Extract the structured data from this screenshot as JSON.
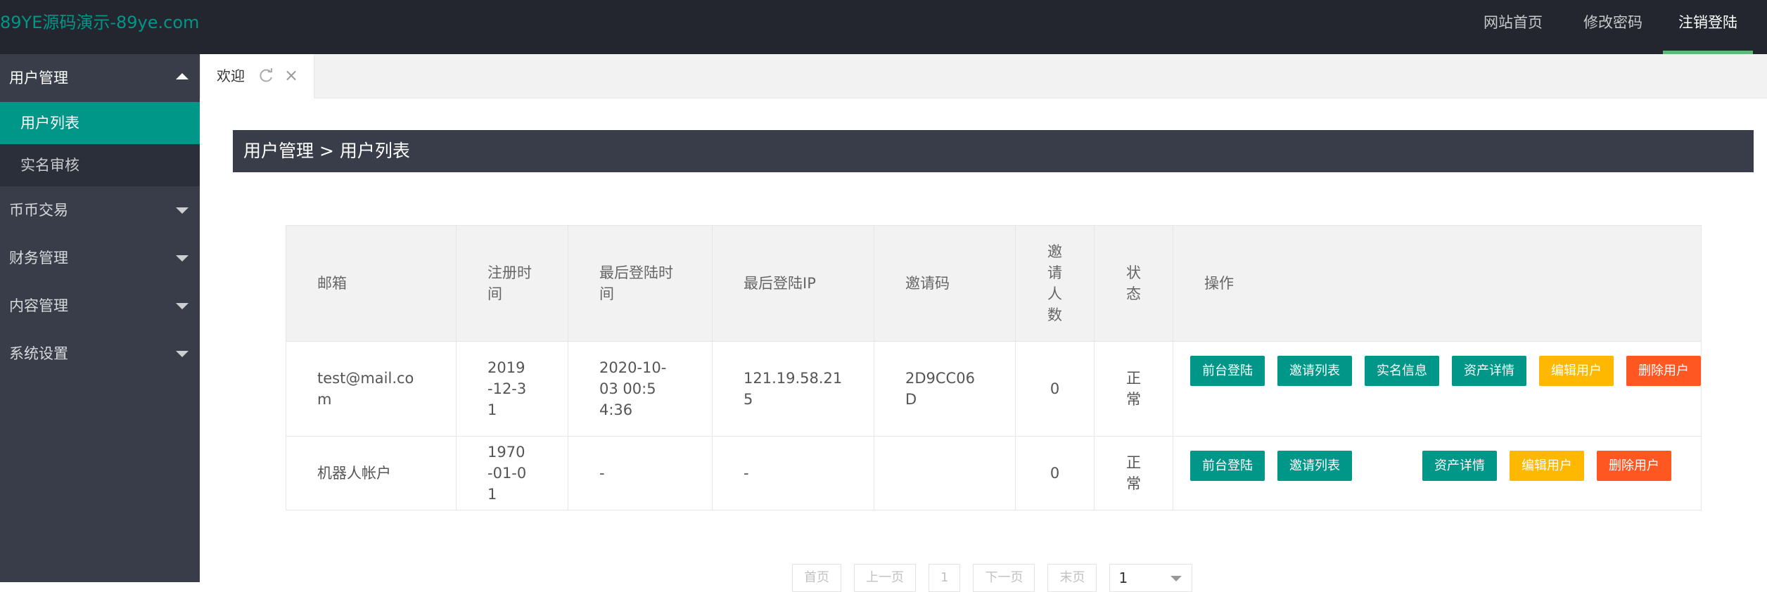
{
  "header": {
    "logo": "89YE源码演示-89ye.com",
    "nav": {
      "home": "网站首页",
      "change_password": "修改密码",
      "logout": "注销登陆"
    }
  },
  "sidebar": {
    "groups": [
      {
        "label": "用户管理",
        "expanded": true,
        "items": [
          {
            "label": "用户列表",
            "active": true
          },
          {
            "label": "实名审核",
            "active": false
          }
        ]
      },
      {
        "label": "币币交易",
        "expanded": false
      },
      {
        "label": "财务管理",
        "expanded": false
      },
      {
        "label": "内容管理",
        "expanded": false
      },
      {
        "label": "系统设置",
        "expanded": false
      }
    ]
  },
  "tabs": [
    {
      "label": "欢迎"
    }
  ],
  "breadcrumb": "用户管理 > 用户列表",
  "table": {
    "headers": {
      "email": "邮箱",
      "reg_time": "注册时间",
      "last_login_time": "最后登陆时间",
      "last_login_ip": "最后登陆IP",
      "invite_code": "邀请码",
      "invite_count": "邀请人数",
      "status": "状态",
      "actions": "操作"
    },
    "rows": [
      {
        "email": "test@mail.com",
        "reg_time": "2019-12-31",
        "last_login_time": "2020-10-03 00:54:36",
        "last_login_ip": "121.19.58.215",
        "invite_code": "2D9CC06D",
        "invite_count": "0",
        "status": "正常"
      },
      {
        "email": "机器人帐户",
        "reg_time": "1970-01-01",
        "last_login_time": "-",
        "last_login_ip": "-",
        "invite_code": "",
        "invite_count": "0",
        "status": "正常"
      }
    ],
    "action_labels": {
      "front_login": "前台登陆",
      "invite_list": "邀请列表",
      "realname_info": "实名信息",
      "asset_detail": "资产详情",
      "edit_user": "编辑用户",
      "delete_user": "删除用户"
    }
  },
  "pager": {
    "first": "首页",
    "prev": "上一页",
    "current": "1",
    "next": "下一页",
    "last": "末页",
    "select_value": "1"
  },
  "colors": {
    "header_bg": "#23262e",
    "sidebar_bg": "#393d49",
    "accent": "#009688",
    "warn": "#ffb800",
    "danger": "#ff5722",
    "nav_underline": "#5fb878"
  }
}
